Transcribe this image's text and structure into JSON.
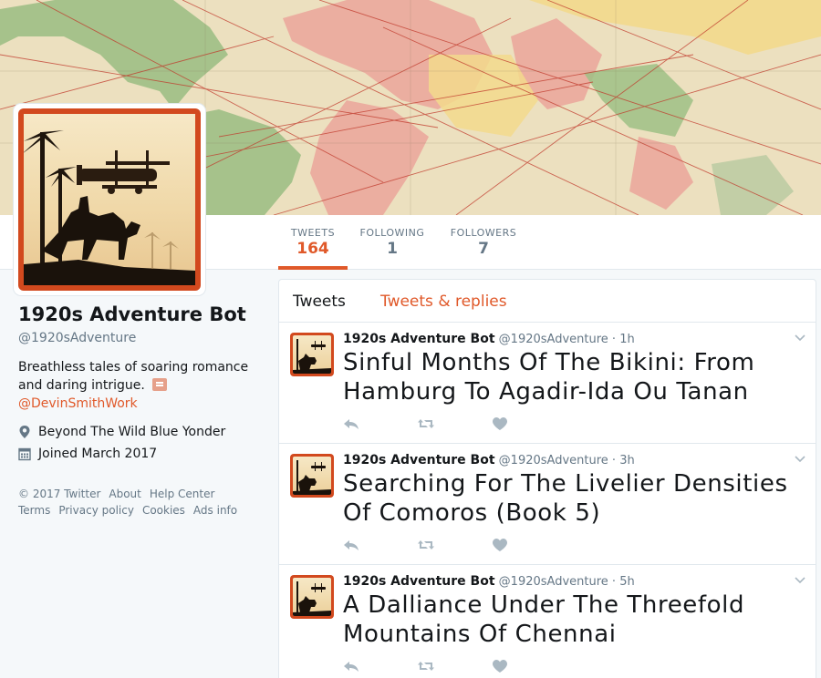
{
  "colors": {
    "accent": "#e0592a",
    "muted": "#657786",
    "text": "#14171a",
    "border": "#e1e8ed"
  },
  "nav": {
    "stats": [
      {
        "label": "TWEETS",
        "value": "164",
        "active": true
      },
      {
        "label": "FOLLOWING",
        "value": "1",
        "active": false
      },
      {
        "label": "FOLLOWERS",
        "value": "7",
        "active": false
      }
    ]
  },
  "profile": {
    "name": "1920s Adventure Bot",
    "handle": "@1920sAdventure",
    "bio": "Breathless tales of soaring romance and daring intrigue.",
    "bio_link": "@DevinSmithWork",
    "location": "Beyond The Wild Blue Yonder",
    "joined": "Joined March 2017",
    "icons": {
      "location": "location-pin-icon",
      "joined": "calendar-icon",
      "bio_emoji": "book-icon"
    }
  },
  "footer": {
    "links": [
      "© 2017 Twitter",
      "About",
      "Help Center",
      "Terms",
      "Privacy policy",
      "Cookies",
      "Ads info"
    ]
  },
  "timeline": {
    "tabs": [
      "Tweets",
      "Tweets & replies"
    ],
    "tweets": [
      {
        "name": "1920s Adventure Bot",
        "handle": "@1920sAdventure",
        "time": "1h",
        "text": "Sinful Months Of The Bikini: From Hamburg To Agadir-Ida Ou Tanan"
      },
      {
        "name": "1920s Adventure Bot",
        "handle": "@1920sAdventure",
        "time": "3h",
        "text": "Searching For The Livelier Densities Of Comoros (Book 5)"
      },
      {
        "name": "1920s Adventure Bot",
        "handle": "@1920sAdventure",
        "time": "5h",
        "text": "A Dalliance Under The Threefold Mountains Of Chennai"
      }
    ],
    "action_icons": [
      "reply-icon",
      "retweet-icon",
      "like-icon"
    ]
  }
}
